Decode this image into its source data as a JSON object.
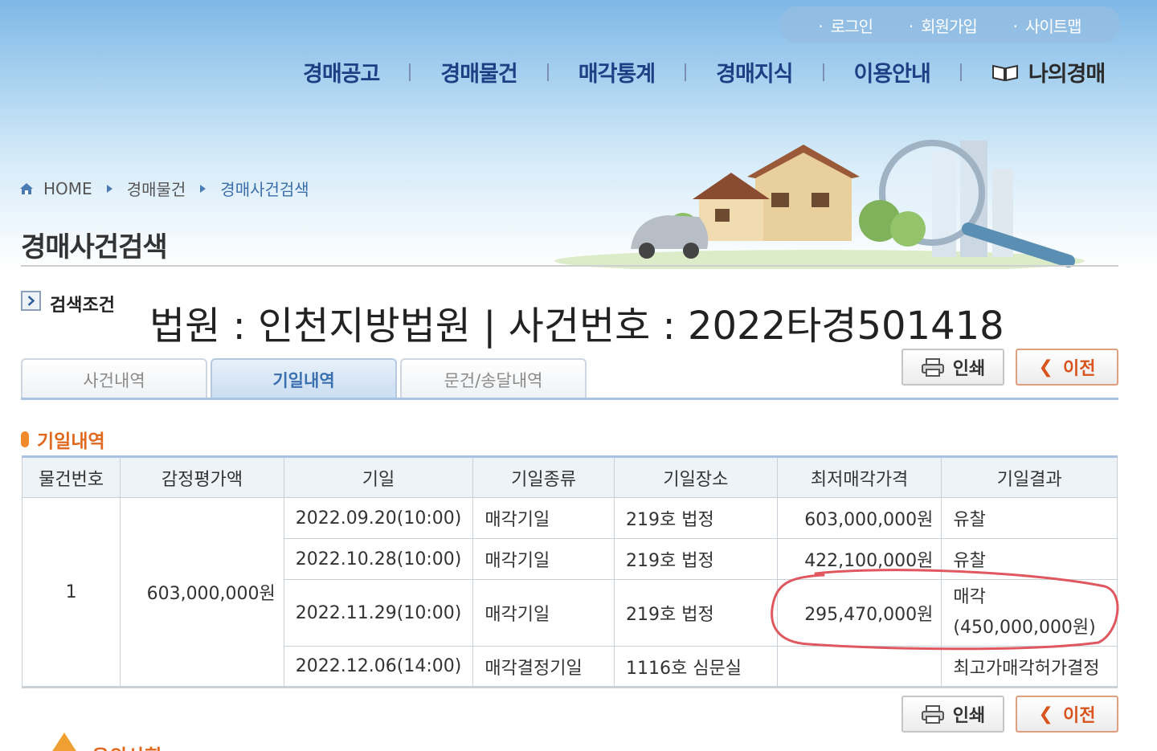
{
  "util_links": [
    "로그인",
    "회원가입",
    "사이트맵"
  ],
  "gnb": [
    "경매공고",
    "경매물건",
    "매각통계",
    "경매지식",
    "이용안내",
    "나의경매"
  ],
  "breadcrumb": [
    "HOME",
    "경매물건",
    "경매사건검색"
  ],
  "page_title": "경매사건검색",
  "search_condition": {
    "label": "검색조건",
    "text": "법원 : 인천지방법원 | 사건번호 : 2022타경501418"
  },
  "buttons": {
    "print": "인쇄",
    "prev": "이전"
  },
  "tabs": [
    {
      "label": "사건내역",
      "active": false
    },
    {
      "label": "기일내역",
      "active": true
    },
    {
      "label": "문건/송달내역",
      "active": false
    }
  ],
  "section_title": "기일내역",
  "table": {
    "headers": [
      "물건번호",
      "감정평가액",
      "기일",
      "기일종류",
      "기일장소",
      "최저매각가격",
      "기일결과"
    ],
    "item_no": "1",
    "appraisal": "603,000,000원",
    "rows": [
      {
        "date": "2022.09.20(10:00)",
        "type": "매각기일",
        "place": "219호 법정",
        "min_price": "603,000,000원",
        "result": "유찰",
        "result_sub": ""
      },
      {
        "date": "2022.10.28(10:00)",
        "type": "매각기일",
        "place": "219호 법정",
        "min_price": "422,100,000원",
        "result": "유찰",
        "result_sub": ""
      },
      {
        "date": "2022.11.29(10:00)",
        "type": "매각기일",
        "place": "219호 법정",
        "min_price": "295,470,000원",
        "result": "매각",
        "result_sub": "(450,000,000원)"
      },
      {
        "date": "2022.12.06(14:00)",
        "type": "매각결정기일",
        "place": "1116호 심문실",
        "min_price": "",
        "result": "최고가매각허가결정",
        "result_sub": ""
      }
    ]
  },
  "notice_title": "유의사항",
  "colors": {
    "accent_orange": "#e0691f",
    "nav_blue": "#1f3f85",
    "circle_red": "#e0585f"
  }
}
